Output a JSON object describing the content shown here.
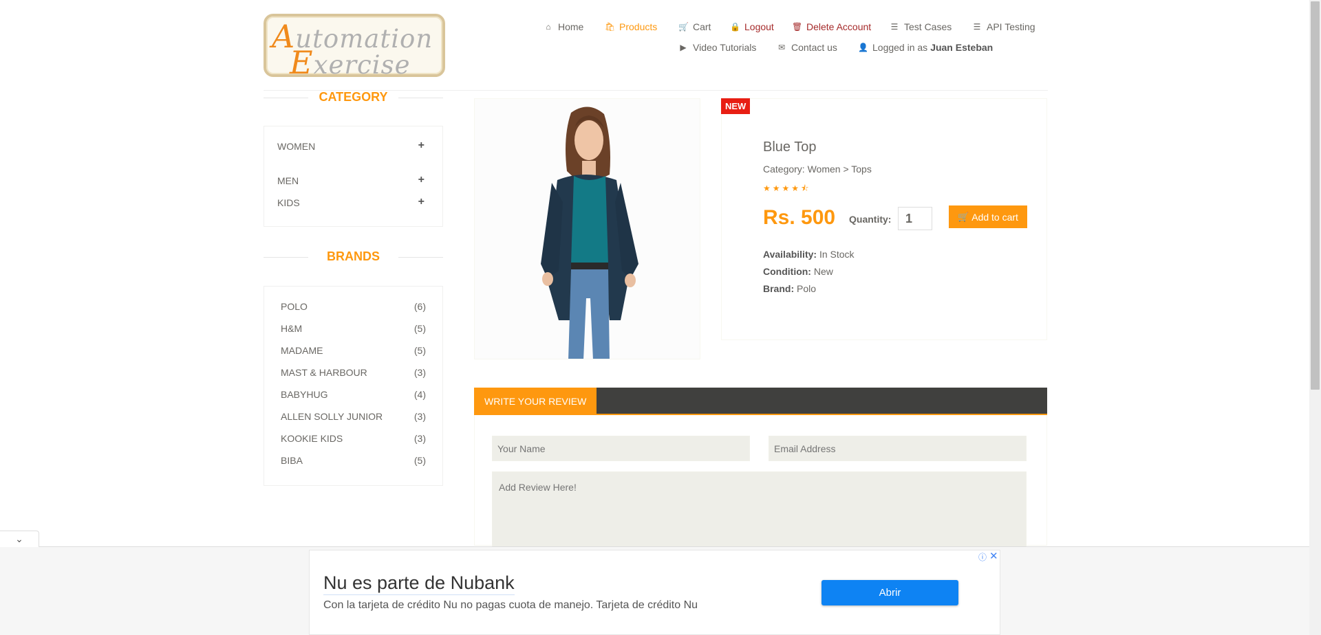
{
  "logo": {
    "line1_big": "A",
    "line1_rest": "utomation",
    "line2_big": "E",
    "line2_rest": "xercise"
  },
  "nav": {
    "home": "Home",
    "products": "Products",
    "cart": "Cart",
    "logout": "Logout",
    "delete_account": "Delete Account",
    "test_cases": "Test Cases",
    "api_testing": "API Testing",
    "video_tutorials": "Video Tutorials",
    "contact_us": "Contact us",
    "logged_in_prefix": "Logged in as",
    "logged_in_user": "Juan Esteban"
  },
  "sidebar": {
    "category_title": "CATEGORY",
    "categories": [
      {
        "label": "WOMEN"
      },
      {
        "label": "MEN"
      },
      {
        "label": "KIDS"
      }
    ],
    "brands_title": "BRANDS",
    "brands": [
      {
        "name": "POLO",
        "count": "(6)"
      },
      {
        "name": "H&M",
        "count": "(5)"
      },
      {
        "name": "MADAME",
        "count": "(5)"
      },
      {
        "name": "MAST & HARBOUR",
        "count": "(3)"
      },
      {
        "name": "BABYHUG",
        "count": "(4)"
      },
      {
        "name": "ALLEN SOLLY JUNIOR",
        "count": "(3)"
      },
      {
        "name": "KOOKIE KIDS",
        "count": "(3)"
      },
      {
        "name": "BIBA",
        "count": "(5)"
      }
    ]
  },
  "product": {
    "badge": "NEW",
    "name": "Blue Top",
    "category": "Category: Women > Tops",
    "rating": 4.5,
    "price": "Rs. 500",
    "quantity_label": "Quantity:",
    "quantity_value": "1",
    "add_to_cart": "Add to cart",
    "availability_label": "Availability:",
    "availability_value": "In Stock",
    "condition_label": "Condition:",
    "condition_value": "New",
    "brand_label": "Brand:",
    "brand_value": "Polo"
  },
  "review": {
    "tab": "WRITE YOUR REVIEW",
    "name_placeholder": "Your Name",
    "email_placeholder": "Email Address",
    "review_placeholder": "Add Review Here!"
  },
  "ad": {
    "title": "Nu es parte de Nubank",
    "subtitle": "Con la tarjeta de crédito Nu no pagas cuota de manejo. Tarjeta de crédito Nu",
    "button": "Abrir"
  },
  "colors": {
    "accent": "#fe980f",
    "danger": "#a52a2a",
    "badge": "#e81e13",
    "tab_bar": "#40403e",
    "ad_button": "#0e83f3"
  }
}
